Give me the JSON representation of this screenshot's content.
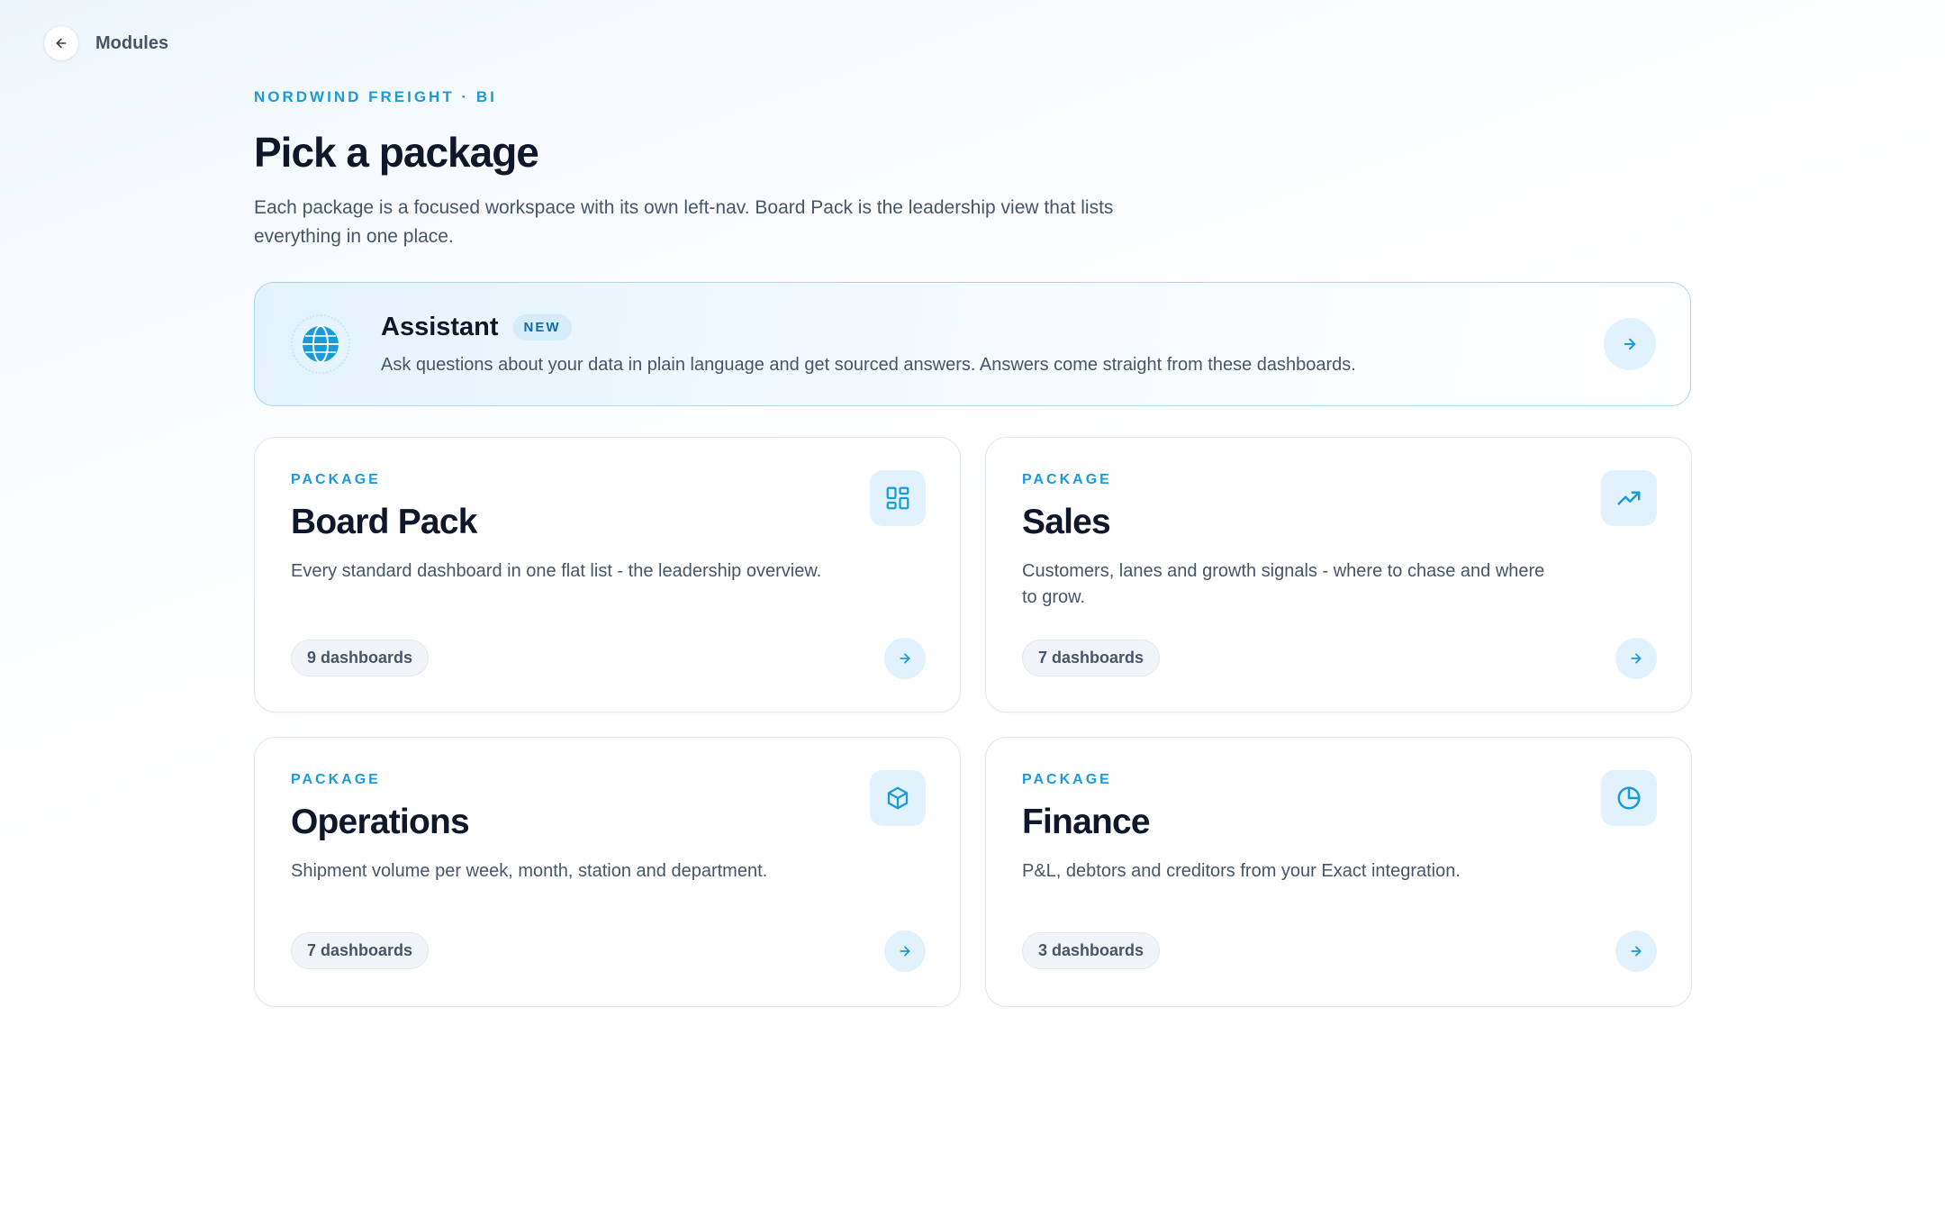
{
  "topbar": {
    "back_label": "Modules"
  },
  "header": {
    "eyebrow": "NORDWIND FREIGHT · BI",
    "title": "Pick a package",
    "intro": "Each package is a focused workspace with its own left-nav. Board Pack is the leadership view that lists everything in one place."
  },
  "assistant": {
    "title": "Assistant",
    "badge": "NEW",
    "description": "Ask questions about your data in plain language and get sourced answers. Answers come straight from these dashboards.",
    "icon": "globe-icon"
  },
  "packages": [
    {
      "eyebrow": "PACKAGE",
      "title": "Board Pack",
      "description": "Every standard dashboard in one flat list - the leadership overview.",
      "count": "9 dashboards",
      "icon": "grid-icon"
    },
    {
      "eyebrow": "PACKAGE",
      "title": "Sales",
      "description": "Customers, lanes and growth signals - where to chase and where to grow.",
      "count": "7 dashboards",
      "icon": "trending-up-icon"
    },
    {
      "eyebrow": "PACKAGE",
      "title": "Operations",
      "description": "Shipment volume per week, month, station and department.",
      "count": "7 dashboards",
      "icon": "box-icon"
    },
    {
      "eyebrow": "PACKAGE",
      "title": "Finance",
      "description": "P&L, debtors and creditors from your Exact integration.",
      "count": "3 dashboards",
      "icon": "pie-chart-icon"
    }
  ],
  "colors": {
    "accent": "#1b9ad8",
    "heading": "#0f172a",
    "body": "#475569",
    "accent_soft": "#e2f2fc"
  }
}
